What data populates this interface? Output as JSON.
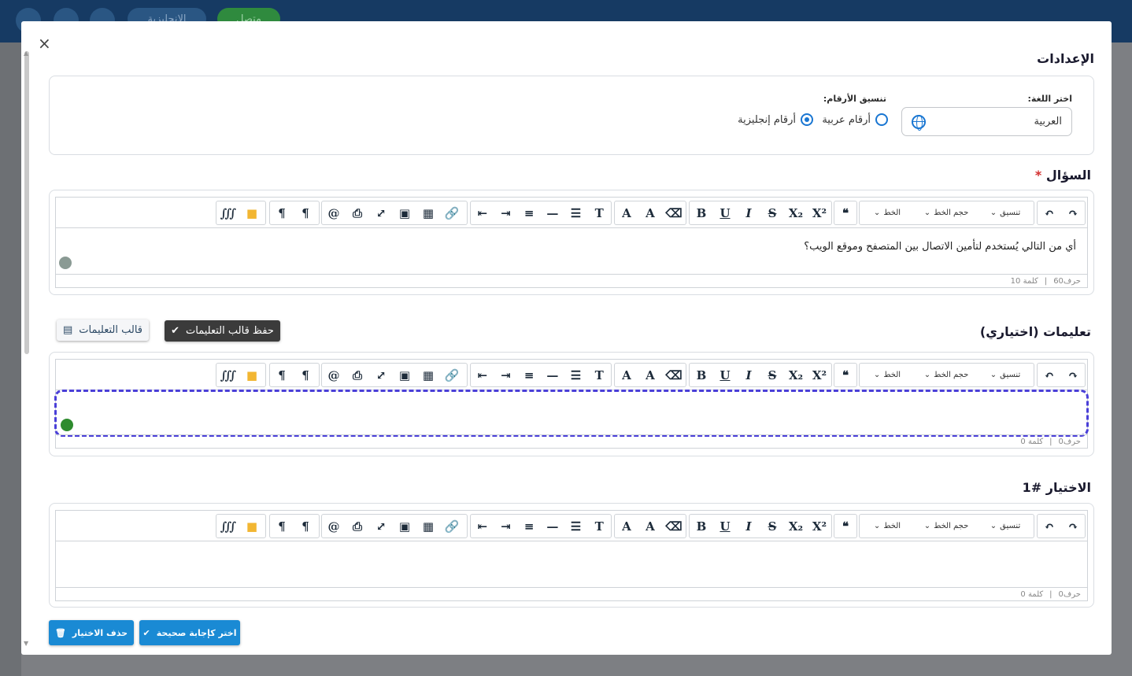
{
  "topbar": {
    "lang_pill": "الإنجليزية",
    "status_pill": "متصل"
  },
  "modal": {
    "close_label": "×",
    "settings_title": "الإعدادات"
  },
  "settings": {
    "lang_label": "اختر اللغة:",
    "lang_value": "العربية",
    "num_label": "تنسيق الأرقام:",
    "num_options": [
      "أرقام عربية",
      "أرقام إنجليزية"
    ]
  },
  "question": {
    "title": "السؤال",
    "required_mark": "*",
    "text": "أي من التالي يُستخدم لتأمين الاتصال بين المتصفح وموقع الويب؟",
    "chars": "حرف60",
    "words": "كلمة 10"
  },
  "instructions": {
    "title": "تعليمات (اختياري)",
    "save_template": "حفظ قالب التعليمات",
    "template": "قالب التعليمات",
    "chars": "حرف0",
    "words": "كلمة 0"
  },
  "choice": {
    "title": "الاختيار #1",
    "chars": "حرف0",
    "words": "كلمة 0"
  },
  "toolbar": {
    "format": "تنسيق",
    "size": "حجم الخط",
    "font": "الخط",
    "sep": "|"
  },
  "actions": {
    "mark_correct": "اختر كإجابة صحيحة",
    "delete_choice": "حذف الاختيار"
  },
  "colors": {
    "accent": "#1a8ad4",
    "topbar": "#163a63",
    "focus": "#4a3fd8"
  }
}
